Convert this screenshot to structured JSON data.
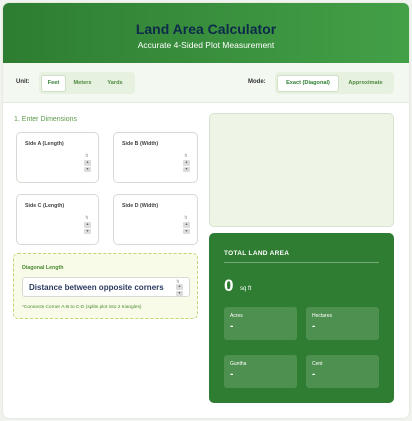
{
  "header": {
    "title": "Land Area Calculator",
    "subtitle": "Accurate 4-Sided Plot Measurement"
  },
  "controls": {
    "unit_label": "Unit:",
    "units": [
      "Feet",
      "Meters",
      "Yards"
    ],
    "unit_selected": "Feet",
    "mode_label": "Mode:",
    "modes": [
      "Exact (Diagonal)",
      "Approximate"
    ],
    "mode_selected": "Exact (Diagonal)"
  },
  "dimensions": {
    "section_title": "1. Enter Dimensions",
    "unit_short": "ft",
    "fields": [
      {
        "label": "Side A (Length)"
      },
      {
        "label": "Side B (Width)"
      },
      {
        "label": "Side C (Length)"
      },
      {
        "label": "Side D (Width)"
      }
    ]
  },
  "diagonal": {
    "label": "Diagonal Length",
    "placeholder": "Distance between opposite corners",
    "unit_short": "ft",
    "note": "*Connects Corner A-B to C-D (splits plot into 2 triangles)"
  },
  "result": {
    "title": "TOTAL LAND AREA",
    "value": "0",
    "unit": "sq ft",
    "cards": [
      {
        "label": "Acres",
        "value": "-"
      },
      {
        "label": "Hectares",
        "value": "-"
      },
      {
        "label": "Guntha",
        "value": "-"
      },
      {
        "label": "Cent",
        "value": "-"
      }
    ]
  },
  "colors": {
    "brand_green": "#2e7d32",
    "title_navy": "#0d2a4a",
    "accent_light_green": "#5a9a4a"
  }
}
